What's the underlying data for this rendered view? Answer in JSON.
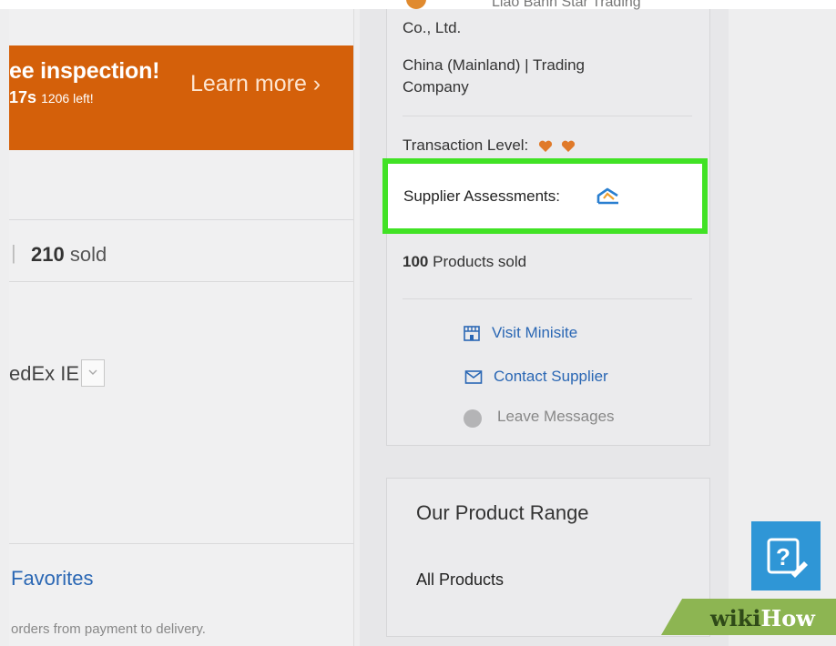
{
  "banner": {
    "title": "ee inspection!",
    "timer": "17s",
    "remaining": "1206 left!",
    "cta": "Learn more ›",
    "color": "#d4600a"
  },
  "product": {
    "sold_count": "210",
    "sold_label": "sold",
    "shipping": "edEx IE",
    "favorites": "Favorites",
    "footer_text": "orders from payment to delivery."
  },
  "supplier": {
    "name_partial": "Liao Bann Star Trading",
    "name_line2": "Co., Ltd.",
    "location": "China (Mainland) | Trading Company",
    "transaction_level_label": "Transaction Level:",
    "assessments_label": "Supplier Assessments:",
    "products_sold_count": "100",
    "products_sold_label": "Products sold",
    "visit_minisite": "Visit Minisite",
    "contact_supplier": "Contact Supplier",
    "leave_messages": "Leave Messages",
    "highlight_color": "#41e225",
    "link_color": "#2a67b4"
  },
  "product_range": {
    "title": "Our Product Range",
    "all_products": "All Products"
  },
  "watermark": {
    "wiki": "wiki",
    "how": "How"
  },
  "icons": {
    "assessment": "assessment-icon",
    "visit": "storefront-icon",
    "contact": "envelope-icon",
    "leave": "message-bubble-icon",
    "help": "help-question-icon"
  }
}
